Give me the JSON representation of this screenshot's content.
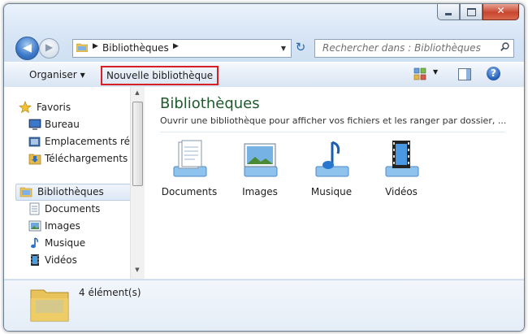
{
  "window": {
    "caption_buttons": {
      "minimize": "minimize",
      "maximize": "maximize",
      "close": "✕"
    }
  },
  "navbar": {
    "back_arrow": "◀",
    "forward_arrow": "▶",
    "breadcrumb": "Bibliothèques",
    "crumb_separator": "▶",
    "dropdown": "▼",
    "refresh": "↻",
    "search_placeholder": "Rechercher dans : Bibliothèques"
  },
  "toolbar": {
    "organize": "Organiser",
    "organize_caret": "▼",
    "new_library": "Nouvelle bibliothèque",
    "view_caret": "▼",
    "help": "?"
  },
  "sidebar": {
    "favorites": {
      "label": "Favoris",
      "icon": "star-icon",
      "items": [
        {
          "label": "Bureau",
          "icon": "desktop-icon"
        },
        {
          "label": "Emplacements ré",
          "icon": "recent-places-icon"
        },
        {
          "label": "Téléchargements",
          "icon": "downloads-icon"
        }
      ]
    },
    "libraries": {
      "label": "Bibliothèques",
      "icon": "library-icon",
      "items": [
        {
          "label": "Documents",
          "icon": "documents-icon"
        },
        {
          "label": "Images",
          "icon": "images-icon"
        },
        {
          "label": "Musique",
          "icon": "music-icon"
        },
        {
          "label": "Vidéos",
          "icon": "videos-icon"
        }
      ]
    }
  },
  "main": {
    "title": "Bibliothèques",
    "subtitle": "Ouvrir une bibliothèque pour afficher vos fichiers et les ranger par dossier, ...",
    "libraries": [
      {
        "label": "Documents",
        "icon": "documents-library-icon"
      },
      {
        "label": "Images",
        "icon": "images-library-icon"
      },
      {
        "label": "Musique",
        "icon": "music-library-icon"
      },
      {
        "label": "Vidéos",
        "icon": "videos-library-icon"
      }
    ]
  },
  "details": {
    "count": "4 élément(s)"
  },
  "colors": {
    "title_green": "#1e5b2c",
    "highlight_border": "#d91f26",
    "selection_bg": "#dce8f6"
  }
}
